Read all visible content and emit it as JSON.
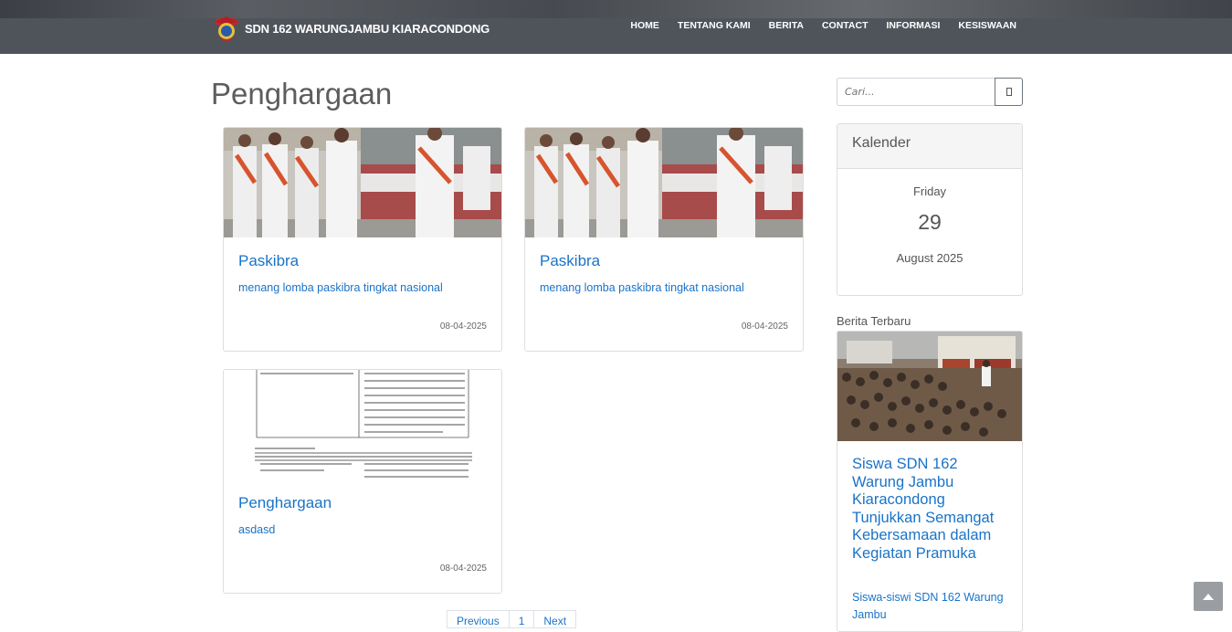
{
  "header": {
    "brand": "SDN 162 WARUNGJAMBU KIARACONDONG",
    "nav": [
      "HOME",
      "TENTANG KAMI",
      "BERITA",
      "CONTACT",
      "INFORMASI",
      "KESISWAAN"
    ]
  },
  "main": {
    "title": "Penghargaan",
    "cards": [
      {
        "title": "Paskibra",
        "text": "menang lomba paskibra tingkat nasional",
        "date": "08-04-2025",
        "image": "paskibra-photo"
      },
      {
        "title": "Paskibra",
        "text": "menang lomba paskibra tingkat nasional",
        "date": "08-04-2025",
        "image": "paskibra-photo"
      },
      {
        "title": "Penghargaan",
        "text": "asdasd",
        "date": "08-04-2025",
        "image": "document-scan"
      }
    ],
    "pagination": [
      "Previous",
      "1",
      "Next"
    ]
  },
  "sidebar": {
    "search": {
      "placeholder": "Cari..."
    },
    "calendar": {
      "title": "Kalender",
      "day": "Friday",
      "date": "29",
      "month": "August 2025"
    },
    "news": {
      "label": "Berita Terbaru",
      "title": "Siswa SDN 162 Warung Jambu Kiaracondong Tunjukkan Semangat Kebersamaan dalam Kegiatan Pramuka",
      "text": "Siswa-siswi SDN 162 Warung Jambu"
    }
  },
  "colors": {
    "link": "#1a73c8",
    "header": "#4f545b",
    "title": "#5d5d5d"
  },
  "icons": {
    "search": "search-icon",
    "back_to_top": "chevron-up-icon",
    "logo": "school-logo"
  }
}
